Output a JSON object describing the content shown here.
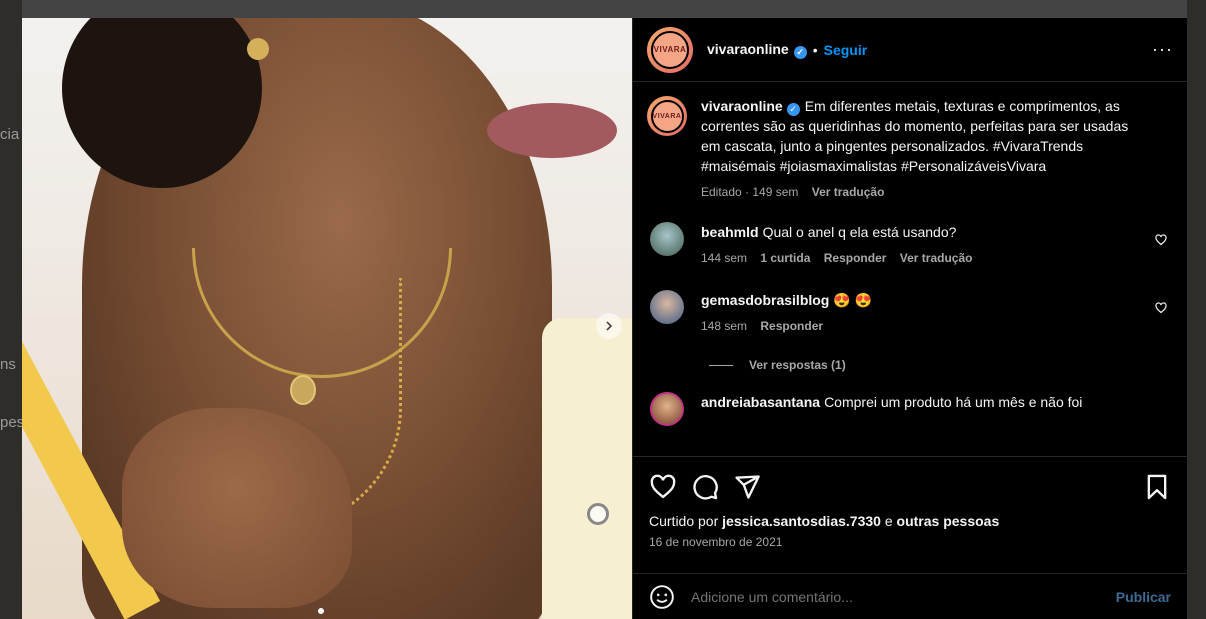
{
  "background": {
    "side_texts": [
      "cia",
      "ns",
      "pes"
    ]
  },
  "post": {
    "author": "vivaraonline",
    "avatar_text": "VIVARA",
    "separator": "•",
    "follow_label": "Seguir",
    "more_label": "···",
    "caption": "Em diferentes metais, texturas e comprimentos, as correntes são as queridinhas do momento, perfeitas para ser usadas em cascata, junto a pingentes personalizados. #VivaraTrends #maisémais #joiasmaximalistas #PersonalizáveisVivara",
    "caption_meta": "Editado · 149 sem",
    "caption_translate": "Ver tradução",
    "verified_glyph": "✓"
  },
  "comments": [
    {
      "user": "beahmld",
      "text": "Qual o anel q ela está usando?",
      "time": "144 sem",
      "likes": "1 curtida",
      "reply": "Responder",
      "translate": "Ver tradução"
    },
    {
      "user": "gemasdobrasilblog",
      "text": "😍 😍",
      "time": "148 sem",
      "reply": "Responder",
      "view_replies": "Ver respostas (1)"
    },
    {
      "user": "andreiabasantana",
      "text": "Comprei um produto há um mês e não foi"
    }
  ],
  "actions": {
    "liked_by_prefix": "Curtido por",
    "liked_by_user": "jessica.santosdias.7330",
    "liked_by_conj": "e",
    "liked_by_others": "outras pessoas",
    "date": "16 de novembro de 2021"
  },
  "comment_box": {
    "placeholder": "Adicione um comentário...",
    "publish_label": "Publicar"
  },
  "colors": {
    "accent": "#0095f6",
    "verified": "#3797f0",
    "panel_bg": "#000000"
  },
  "icons": {
    "heart": "heart-icon",
    "comment": "comment-icon",
    "share": "share-icon",
    "save": "bookmark-icon",
    "emoji": "emoji-icon",
    "next": "chevron-right-icon"
  }
}
